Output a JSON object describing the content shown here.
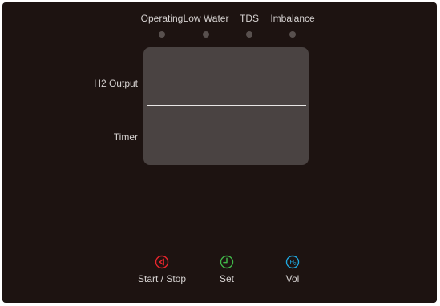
{
  "indicators": [
    {
      "label": "Operating"
    },
    {
      "label": "Low Water"
    },
    {
      "label": "TDS"
    },
    {
      "label": "Imbalance"
    }
  ],
  "display": {
    "h2_output_label": "H2 Output",
    "timer_label": "Timer"
  },
  "controls": [
    {
      "label": "Start / Stop",
      "icon": "play-icon",
      "color": "#e8262d"
    },
    {
      "label": "Set",
      "icon": "clock-icon",
      "color": "#41b649"
    },
    {
      "label": "Vol",
      "icon": "h2-icon",
      "color": "#1fa7df"
    }
  ],
  "colors": {
    "background": "#1d1311",
    "screen": "#4a4342",
    "led_off": "#58504e",
    "text": "#d6d2d1"
  }
}
